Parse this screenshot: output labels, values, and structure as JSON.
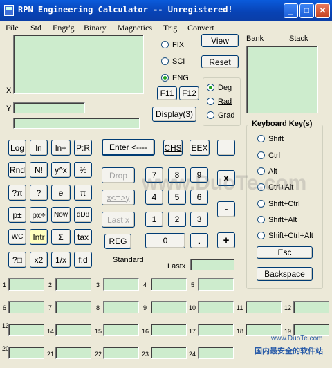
{
  "window": {
    "title": "RPN Engineering Calculator -- Unregistered!"
  },
  "menu": [
    "File",
    "Std",
    "Engr'g",
    "Binary",
    "Magnetics",
    "Trig",
    "Convert"
  ],
  "display": {
    "x_label": "X",
    "y_label": "Y"
  },
  "modes": {
    "fix": "FIX",
    "sci": "SCI",
    "eng": "ENG",
    "selected": "eng"
  },
  "buttons": {
    "view": "View",
    "reset": "Reset",
    "f11": "F11",
    "f12": "F12",
    "display3": "Display(3)",
    "enter": "Enter <----",
    "chs": "CHS",
    "eex": "EEX",
    "log": "Log",
    "ln": "ln",
    "lnplus": "ln+",
    "pr": "P:R",
    "rnd": "Rnd",
    "nfact": "N!",
    "ypowx": "y^x",
    "pct": "%",
    "qpi": "?π",
    "q": "?",
    "e": "e",
    "pi": "π",
    "ppm": "p±",
    "pdiv": "px÷",
    "now": "Now",
    "dd8": "dD8",
    "wc": "WC",
    "intr": "Intr",
    "sigma": "Σ",
    "tax": "tax",
    "qbox": "?□",
    "x2": "x2",
    "inv": "1/x",
    "fd": "f:d",
    "drop": "Drop",
    "xswap": "x<=>y",
    "lastx": "Last x",
    "reg": "REG",
    "n7": "7",
    "n8": "8",
    "n9": "9",
    "n4": "4",
    "n5": "5",
    "n6": "6",
    "n1": "1",
    "n2": "2",
    "n3": "3",
    "n0": "0",
    "dot": ".",
    "mul": "x",
    "sub": "-",
    "add": "+"
  },
  "angle": {
    "deg": "Deg",
    "rad": "Rad",
    "grad": "Grad",
    "selected": "deg"
  },
  "bank_label": "Bank",
  "stack_label": "Stack",
  "keyboard": {
    "title": "Keyboard Key(s)",
    "options": [
      "Shift",
      "Ctrl",
      "Alt",
      "Ctrl+Alt",
      "Shift+Ctrl",
      "Shift+Alt",
      "Shift+Ctrl+Alt"
    ],
    "esc": "Esc",
    "backspace": "Backspace"
  },
  "status": {
    "standard": "Standard",
    "lastx": "Lastx"
  },
  "registers": [
    "1",
    "2",
    "3",
    "4",
    "5",
    "6",
    "7",
    "8",
    "9",
    "10",
    "11",
    "12",
    "13",
    "14",
    "15",
    "16",
    "17",
    "18",
    "19",
    "20",
    "21",
    "22",
    "23",
    "24"
  ],
  "watermark": "www.DuoTe.com",
  "watermark_small": "www.DuoTe.com",
  "watermark_bottom": "国内最安全的软件站"
}
